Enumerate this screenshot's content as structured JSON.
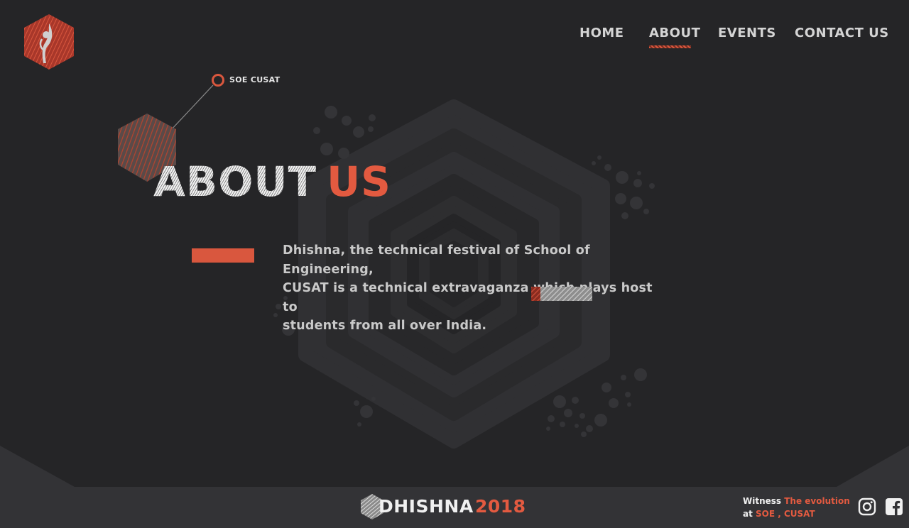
{
  "brand": {
    "logo_icon": "dhishna-figure-hexagon-icon",
    "accent_color": "#e35a40",
    "background_color": "#252527"
  },
  "nav": {
    "items": [
      {
        "label": "HOME"
      },
      {
        "label": "ABOUT",
        "active": true
      },
      {
        "label": "EVENTS"
      },
      {
        "label": "CONTACT  US"
      }
    ]
  },
  "pointer": {
    "label": "SOE CUSAT"
  },
  "main": {
    "heading_part1": "ABOUT",
    "heading_part2": "US",
    "description_line1": "Dhishna, the technical festival of School of Engineering,",
    "description_line2": "CUSAT  is a technical extravaganza which plays host to",
    "description_line3": "students from all over India."
  },
  "footer": {
    "brand_name": "DHISHNA",
    "year": "2018",
    "tagline_witness": "Witness",
    "tagline_evolution": "The evolution",
    "tagline_at": "at",
    "tagline_place": "SOE , CUSAT",
    "social_icons": [
      "instagram-icon",
      "facebook-icon"
    ]
  }
}
